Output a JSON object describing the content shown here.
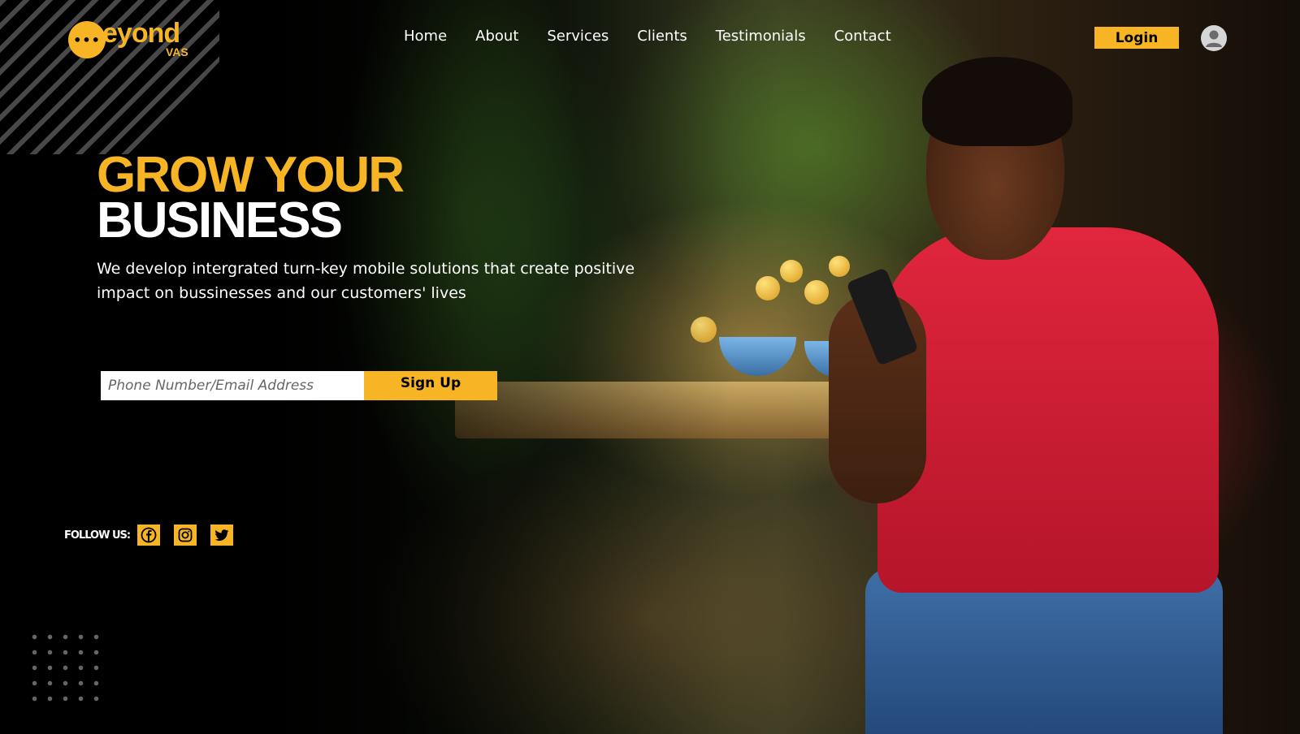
{
  "brand": {
    "name": "eyond",
    "sub": "VAS",
    "accent_color": "#f7b526"
  },
  "nav": {
    "items": [
      {
        "label": "Home"
      },
      {
        "label": "About"
      },
      {
        "label": "Services"
      },
      {
        "label": "Clients"
      },
      {
        "label": "Testimonials"
      },
      {
        "label": "Contact"
      }
    ],
    "login_label": "Login",
    "user_icon": "user-icon"
  },
  "hero": {
    "headline_line1": "GROW YOUR",
    "headline_line2": "BUSINESS",
    "subtext": "We develop intergrated turn-key mobile solutions that create positive impact on bussinesses and our customers' lives",
    "signup": {
      "placeholder": "Phone Number/Email Address",
      "value": "",
      "button_label": "Sign Up"
    }
  },
  "follow": {
    "label": "FOLLOW US:",
    "icons": [
      "facebook-icon",
      "instagram-icon",
      "twitter-icon"
    ]
  }
}
